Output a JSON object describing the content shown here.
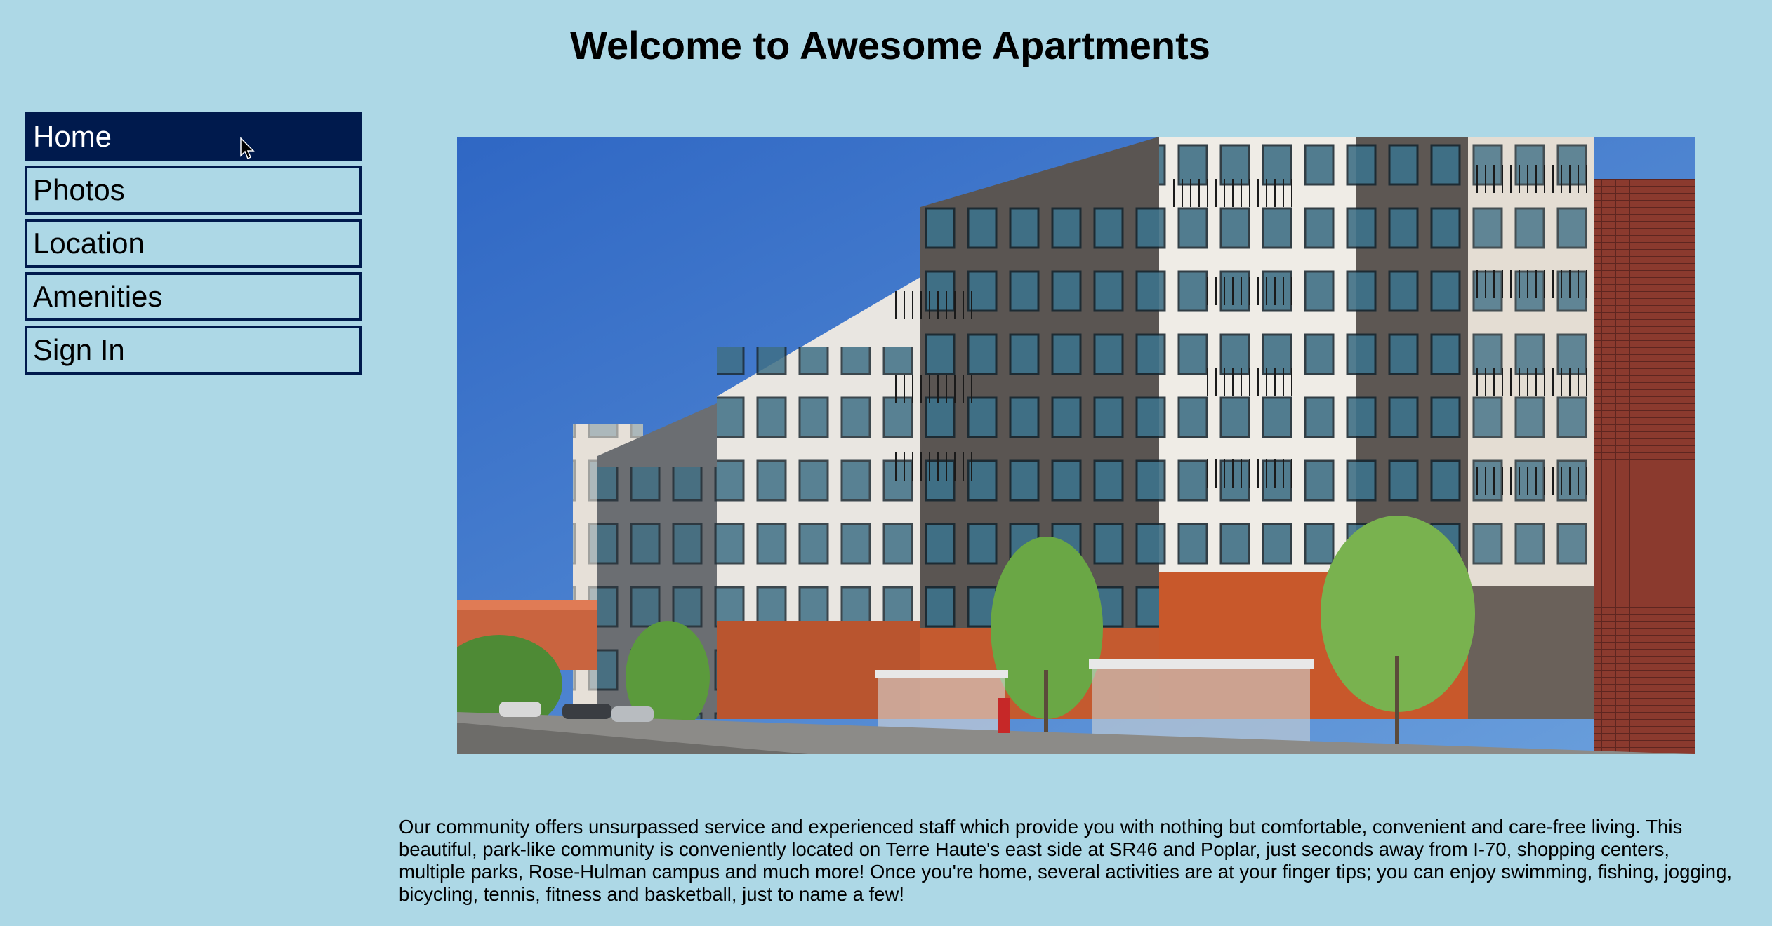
{
  "page": {
    "title": "Welcome to Awesome Apartments"
  },
  "nav": {
    "items": [
      {
        "label": "Home",
        "active": true
      },
      {
        "label": "Photos",
        "active": false
      },
      {
        "label": "Location",
        "active": false
      },
      {
        "label": "Amenities",
        "active": false
      },
      {
        "label": "Sign In",
        "active": false
      }
    ]
  },
  "hero": {
    "content": "photo of a modern multi-story apartment complex along a city street"
  },
  "main": {
    "description": "Our community offers unsurpassed service and experienced staff which provide you with nothing but comfortable, convenient and care-free living. This beautiful, park-like community is conveniently located on Terre Haute's east side at SR46 and Poplar, just seconds away from I-70, shopping centers, multiple parks, Rose-Hulman campus and much more! Once you're home, several activities are at your finger tips; you can enjoy swimming, fishing, jogging, bicycling, tennis, fitness and basketball, just to name a few!"
  },
  "colors": {
    "background": "#add8e6",
    "nav_border": "#001a4d",
    "nav_active_bg": "#001a4d"
  }
}
